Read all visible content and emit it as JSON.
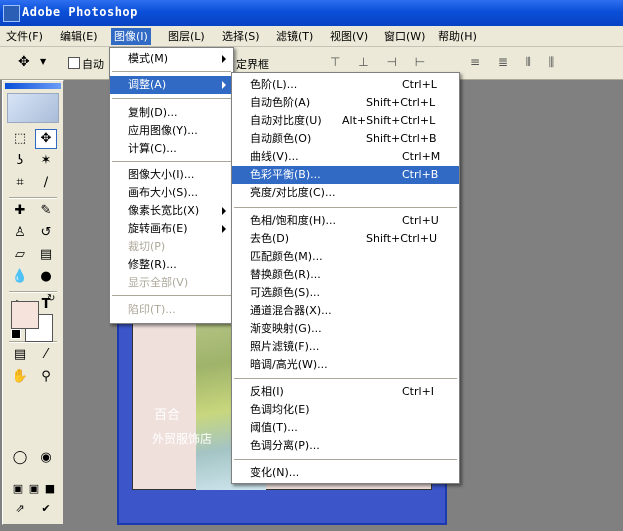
{
  "app": {
    "title": "Adobe Photoshop"
  },
  "menubar": [
    "文件(F)",
    "编辑(E)",
    "图像(I)",
    "图层(L)",
    "选择(S)",
    "滤镜(T)",
    "视图(V)",
    "窗口(W)",
    "帮助(H)"
  ],
  "options": {
    "auto_label": "自动",
    "bounds_label": "定界框"
  },
  "image_menu": {
    "items": [
      "模式(M)",
      "调整(A)",
      "复制(D)...",
      "应用图像(Y)...",
      "计算(C)...",
      "图像大小(I)...",
      "画布大小(S)...",
      "像素长宽比(X)",
      "旋转画布(E)",
      "裁切(P)",
      "修整(R)...",
      "显示全部(V)",
      "陷印(T)..."
    ]
  },
  "adjust_menu": {
    "items": [
      {
        "label": "色阶(L)...",
        "shortcut": "Ctrl+L"
      },
      {
        "label": "自动色阶(A)",
        "shortcut": "Shift+Ctrl+L"
      },
      {
        "label": "自动对比度(U)",
        "shortcut": "Alt+Shift+Ctrl+L"
      },
      {
        "label": "自动颜色(O)",
        "shortcut": "Shift+Ctrl+B"
      },
      {
        "label": "曲线(V)...",
        "shortcut": "Ctrl+M"
      },
      {
        "label": "色彩平衡(B)...",
        "shortcut": "Ctrl+B"
      },
      {
        "label": "亮度/对比度(C)...",
        "shortcut": ""
      },
      {
        "label": "色相/饱和度(H)...",
        "shortcut": "Ctrl+U"
      },
      {
        "label": "去色(D)",
        "shortcut": "Shift+Ctrl+U"
      },
      {
        "label": "匹配颜色(M)...",
        "shortcut": ""
      },
      {
        "label": "替换颜色(R)...",
        "shortcut": ""
      },
      {
        "label": "可选颜色(S)...",
        "shortcut": ""
      },
      {
        "label": "通道混合器(X)...",
        "shortcut": ""
      },
      {
        "label": "渐变映射(G)...",
        "shortcut": ""
      },
      {
        "label": "照片滤镜(F)...",
        "shortcut": ""
      },
      {
        "label": "暗调/高光(W)...",
        "shortcut": ""
      },
      {
        "label": "反相(I)",
        "shortcut": "Ctrl+I"
      },
      {
        "label": "色调均化(E)",
        "shortcut": ""
      },
      {
        "label": "阈值(T)...",
        "shortcut": ""
      },
      {
        "label": "色调分离(P)...",
        "shortcut": ""
      },
      {
        "label": "变化(N)...",
        "shortcut": ""
      }
    ]
  },
  "document": {
    "text1": "百合",
    "text2": "外贸服饰店"
  }
}
